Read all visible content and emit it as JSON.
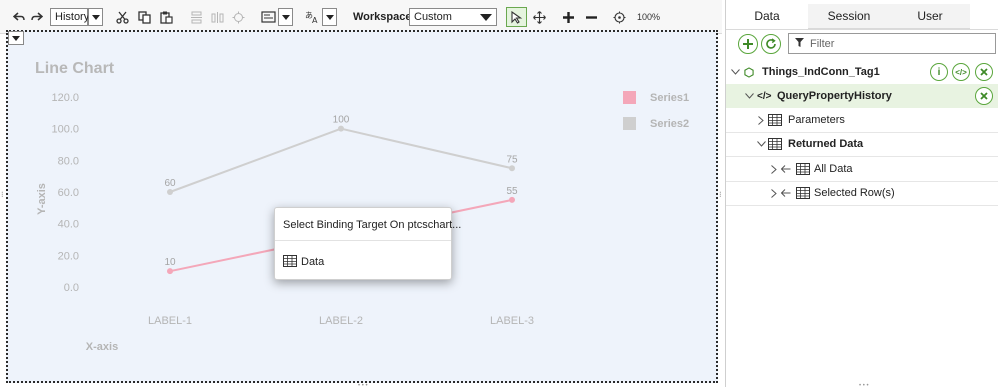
{
  "toolbar": {
    "history_label": "History",
    "workspace_label": "Workspace",
    "workspace_value": "Custom",
    "zoom": "100%"
  },
  "chart_data": {
    "type": "line",
    "title": "Line Chart",
    "xlabel": "X-axis",
    "ylabel": "Y-axis",
    "categories": [
      "LABEL-1",
      "LABEL-2",
      "LABEL-3"
    ],
    "yticks": [
      "120.0",
      "100.0",
      "80.0",
      "60.0",
      "40.0",
      "20.0",
      "0.0"
    ],
    "ylim": [
      0,
      120
    ],
    "grid": false,
    "legend_position": "top-right",
    "series": [
      {
        "name": "Series1",
        "values": [
          10,
          null,
          55
        ],
        "color": "#f4a7b9"
      },
      {
        "name": "Series2",
        "values": [
          60,
          100,
          75
        ],
        "color": "#cfcfcf"
      }
    ]
  },
  "popup": {
    "title": "Select Binding Target On ptcschart...",
    "item_label": "Data"
  },
  "panel": {
    "tabs": [
      {
        "label": "Data",
        "active": true
      },
      {
        "label": "Session",
        "active": false
      },
      {
        "label": "User",
        "active": false
      }
    ],
    "filter_placeholder": "Filter",
    "tree": {
      "thing": "Things_IndConn_Tag1",
      "service": "QueryPropertyHistory",
      "parameters": "Parameters",
      "returned_data": "Returned Data",
      "all_data": "All Data",
      "selected_rows": "Selected Row(s)"
    }
  },
  "colors": {
    "accent_green": "#5aa63c",
    "canvas_bg": "#eef3fb",
    "highlight_row": "#e8f3e1"
  }
}
